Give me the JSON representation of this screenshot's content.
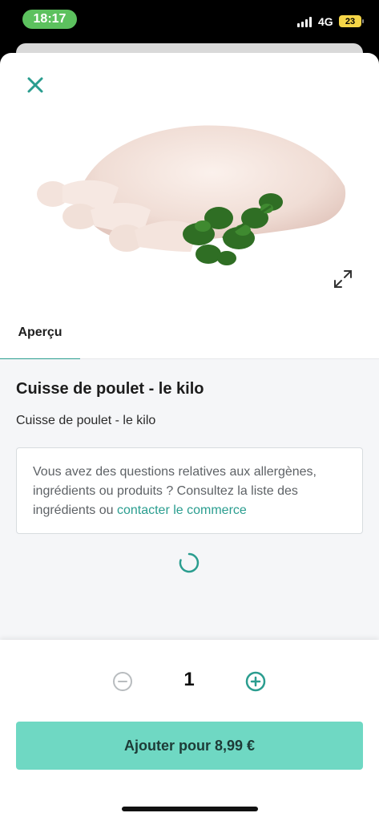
{
  "status_bar": {
    "time": "18:17",
    "network": "4G",
    "battery": "23",
    "time_pill_color": "#5cc15e",
    "battery_color": "#f5d547"
  },
  "header": {
    "close_icon": "close-icon",
    "expand_icon": "expand-icon",
    "image": "chicken-leg-with-parsley"
  },
  "tabs": [
    {
      "label": "Aperçu",
      "active": true
    }
  ],
  "product": {
    "title": "Cuisse de poulet - le kilo",
    "description": "Cuisse de poulet - le kilo"
  },
  "info_box": {
    "text": "Vous avez des questions relatives aux allergènes, ingrédients ou produits ? Consultez la liste des ingrédients ou ",
    "link_text": "contacter le commerce"
  },
  "quantity": {
    "value": "1",
    "minus_icon": "minus-circle-icon",
    "plus_icon": "plus-circle-icon"
  },
  "add_button": {
    "label": "Ajouter pour 8,99 €"
  },
  "colors": {
    "accent": "#2a9d8f",
    "add_button_bg": "#6fd8c3",
    "panel_bg": "#f5f6f8"
  }
}
